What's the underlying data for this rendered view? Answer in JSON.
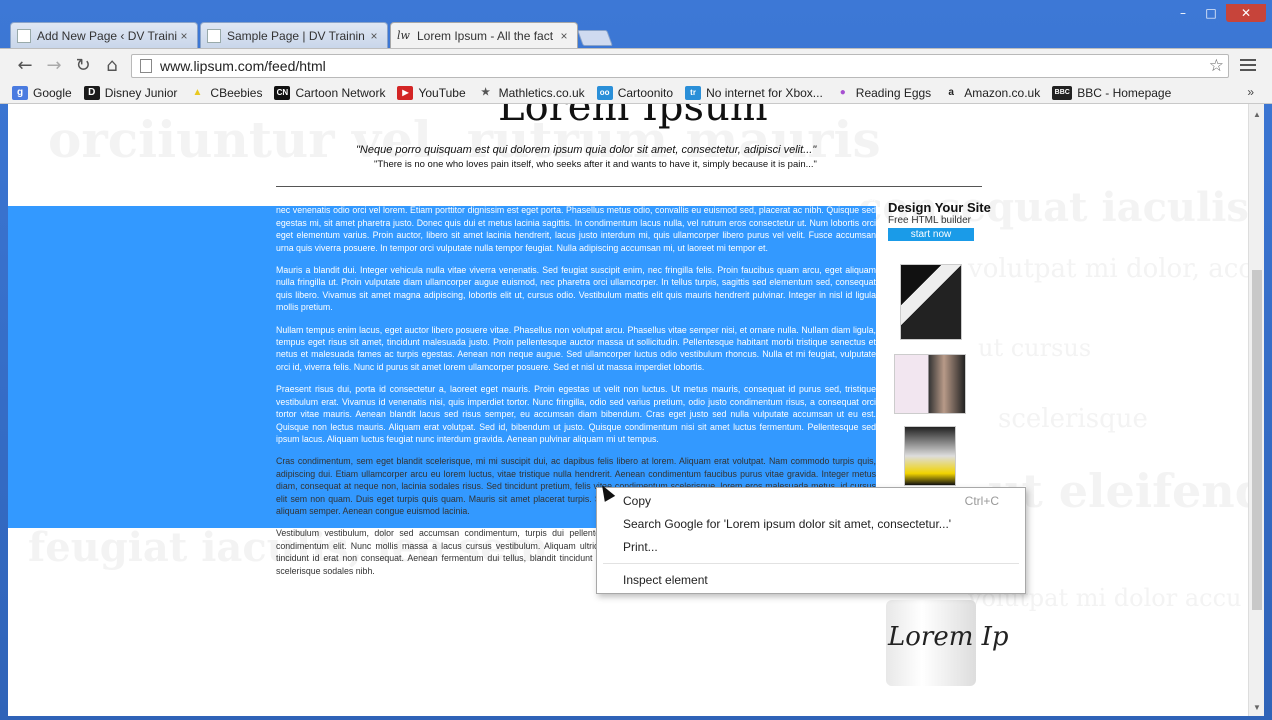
{
  "window": {
    "minimize": "–",
    "restore": "□",
    "close": "✕"
  },
  "tabs": [
    {
      "title": "Add New Page ‹ DV Traini",
      "close": "×",
      "icon": "page-icon"
    },
    {
      "title": "Sample Page | DV Trainin",
      "close": "×",
      "icon": "page-icon"
    },
    {
      "title": "Lorem Ipsum - All the fact",
      "close": "×",
      "icon": "lorem-icon",
      "icon_text": "lw",
      "active": true
    }
  ],
  "toolbar": {
    "back": "←",
    "forward": "→",
    "reload": "↻",
    "home": "⌂",
    "url": "www.lipsum.com/feed/html",
    "star": "☆"
  },
  "bookmarks": [
    {
      "label": "Google",
      "icon": "google-icon",
      "glyph": "g",
      "color": "#4a7be0"
    },
    {
      "label": "Disney Junior",
      "icon": "disney-junior-icon",
      "glyph": "D",
      "color": "#1b1b1b"
    },
    {
      "label": "CBeebies",
      "icon": "cbeebies-icon",
      "glyph": "▲",
      "color": "#e8c820"
    },
    {
      "label": "Cartoon Network",
      "icon": "cartoon-network-icon",
      "glyph": "CN",
      "color": "#111"
    },
    {
      "label": "YouTube",
      "icon": "youtube-icon",
      "glyph": "▶",
      "color": "#d32525"
    },
    {
      "label": "Mathletics.co.uk",
      "icon": "mathletics-icon",
      "glyph": "★",
      "color": "#555"
    },
    {
      "label": "Cartoonito",
      "icon": "cartoonito-icon",
      "glyph": "oo",
      "color": "#2a8fd8"
    },
    {
      "label": "No internet for Xbox...",
      "icon": "tr-icon",
      "glyph": "tr",
      "color": "#2a8fd8"
    },
    {
      "label": "Reading Eggs",
      "icon": "reading-eggs-icon",
      "glyph": "●",
      "color": "#a64fd0"
    },
    {
      "label": "Amazon.co.uk",
      "icon": "amazon-icon",
      "glyph": "a",
      "color": "#222"
    },
    {
      "label": "BBC - Homepage",
      "icon": "bbc-icon",
      "glyph": "BBC",
      "color": "#222"
    }
  ],
  "bookmarks_more": "»",
  "page": {
    "heading_partial": "Lorem Ipsum",
    "quote_latin": "\"Neque porro quisquam est qui dolorem ipsum quia dolor sit amet, consectetur, adipisci velit...\"",
    "quote_english": "\"There is no one who loves pain itself, who seeks after it and wants to have it, simply because it is pain...\"",
    "paragraphs": [
      "Lorem ipsum dolor sit amet, consectetur adipiscing elit. Aliquam vel urna sapien. Vivamus posuere, lacus quis molestie tincidunt, nibh ligula sagittis purus, nec venenatis odio orci vel lorem. Etiam porttitor dignissim est eget porta. Phasellus metus odio, convallis eu euismod sed, placerat ac nibh. Quisque sed egestas mi, sit amet pharetra justo. Donec quis dui et metus lacinia sagittis. In condimentum lacus nulla, vel rutrum eros consectetur ut. Num lobortis orci eget elementum varius. Proin auctor, libero sit amet lacinia hendrerit, lacus justo interdum mi, quis ullamcorper libero purus vel velit. Fusce accumsan urna quis viverra posuere. In tempor orci vulputate nulla tempor feugiat. Nulla adipiscing accumsan mi, ut laoreet mi tempor et.",
      "Mauris a blandit dui. Integer vehicula nulla vitae viverra venenatis. Sed feugiat suscipit enim, nec fringilla felis. Proin faucibus quam arcu, eget aliquam nulla fringilla ut. Proin vulputate diam ullamcorper augue euismod, nec pharetra orci ullamcorper. In tellus turpis, sagittis sed elementum sed, consequat quis libero. Vivamus sit amet magna adipiscing, lobortis elit ut, cursus odio. Vestibulum mattis elit quis mauris hendrerit pulvinar. Integer in nisl id ligula mollis pretium.",
      "Nullam tempus enim lacus, eget auctor libero posuere vitae. Phasellus non volutpat arcu. Phasellus vitae semper nisi, et ornare nulla. Nullam diam ligula, tempus eget risus sit amet, tincidunt malesuada justo. Proin pellentesque auctor massa ut sollicitudin. Pellentesque habitant morbi tristique senectus et netus et malesuada fames ac turpis egestas. Aenean non neque augue. Sed ullamcorper luctus odio vestibulum rhoncus. Nulla et mi feugiat, vulputate orci id, viverra felis. Nunc id purus sit amet lorem ullamcorper posuere. Sed et nisl ut massa imperdiet lobortis.",
      "Praesent risus dui, porta id consectetur a, laoreet eget mauris. Proin egestas ut velit non luctus. Ut metus mauris, consequat id purus sed, tristique vestibulum erat. Vivamus id venenatis nisi, quis imperdiet tortor. Nunc fringilla, odio sed varius pretium, odio justo condimentum risus, a consequat orci tortor vitae mauris. Aenean blandit lacus sed risus semper, eu accumsan diam bibendum. Cras eget justo sed nulla vulputate accumsan ut eu est. Quisque non lectus mauris. Aliquam erat volutpat. Sed id, bibendum ut justo. Quisque condimentum nisi sit amet luctus fermentum. Pellentesque sed ipsum lacus. Aliquam luctus feugiat nunc interdum gravida. Aenean pulvinar aliquam mi ut tempus.",
      "Cras condimentum, sem eget blandit scelerisque, mi mi suscipit dui, ac dapibus felis libero at lorem. Aliquam erat volutpat. Nam commodo turpis quis, adipiscing dui. Etiam ullamcorper arcu eu lorem luctus, vitae tristique nulla hendrerit. Aenean condimentum faucibus purus vitae gravida. Integer metus diam, consequat at neque non, lacinia sodales risus. Sed tincidunt pretium, felis vitae condimentum scelerisque, lorem eros malesuada metus, id cursus elit sem non quam. Duis eget turpis quis quam. Mauris sit amet placerat turpis. Sed laoreet semper diam at ultrices. Curabitur interdum lorem vel nibh aliquam semper. Aenean congue euismod lacinia.",
      "Vestibulum vestibulum, dolor sed accumsan condimentum, turpis dui pellentesque est, sit amet ultrices nisi justo nec justo. Mauris commodo condimentum elit. Nunc mollis massa a lacus cursus vestibulum. Aliquam ultrices metus pulvinar, pretium velit rhoncus, porta mauris. Pellentesque tincidunt id erat non consequat. Aenean fermentum dui tellus, blandit tincidunt purus euismod sit amet. Proin ligula felis, condimentum sed dolor in, scelerisque sodales nibh."
    ],
    "background_words": [
      "orciiuntur vel. rutrum mauris",
      "consequat iaculis, leo sem",
      "volutpat mi dolor, accu",
      "ut cursus",
      "scelerisque",
      "ut eleifend vel. m",
      "feugiat iaculis, leo sem",
      "volutpat mi dolor accu"
    ]
  },
  "ad": {
    "title": "Design Your Site",
    "subtitle": "Free HTML builder",
    "button": "start now",
    "button_color": "#1a9be8"
  },
  "mug_text": "Lorem Ip",
  "context_menu": {
    "copy": "Copy",
    "copy_shortcut": "Ctrl+C",
    "search": "Search Google for 'Lorem ipsum dolor sit amet, consectetur...'",
    "print": "Print...",
    "inspect": "Inspect element"
  },
  "colors": {
    "selection": "#3399ff",
    "frame": "#3d78d6"
  }
}
